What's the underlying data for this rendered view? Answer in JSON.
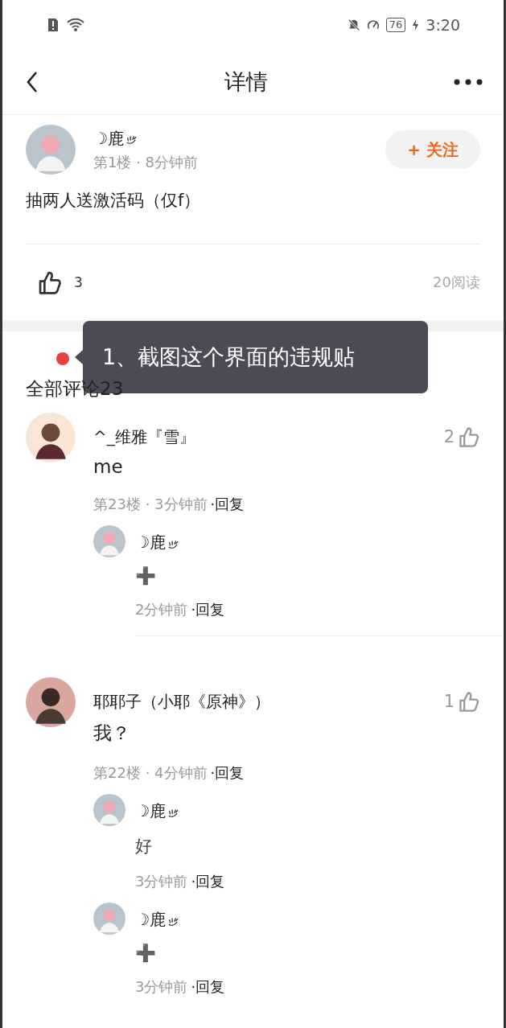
{
  "status_bar": {
    "battery": "76",
    "time": "3:20"
  },
  "header": {
    "title": "详情"
  },
  "post": {
    "author": "☽鹿",
    "floor_time": "第1楼 · 8分钟前",
    "follow": "+ 关注",
    "content": "抽两人送激活码（仅f）",
    "likes": "3",
    "reads": "20阅读"
  },
  "comments_header": "全部评论23",
  "tooltip": "1、截图这个界面的违规贴",
  "comments": [
    {
      "author": "^_维雅『雪』",
      "likes": "2",
      "content": "me",
      "floor_time": "第23楼 · 3分钟前",
      "reply": "·回复",
      "replies": [
        {
          "author": "☽鹿",
          "content": "➕",
          "time": "2分钟前",
          "reply": "·回复"
        }
      ]
    },
    {
      "author": "耶耶子（小耶《原神》）",
      "likes": "1",
      "content": "我？",
      "floor_time": "第22楼 · 4分钟前",
      "reply": "·回复",
      "replies": [
        {
          "author": "☽鹿",
          "content": "好",
          "time": "3分钟前",
          "reply": "·回复"
        },
        {
          "author": "☽鹿",
          "content": "➕",
          "time": "3分钟前",
          "reply": "·回复"
        }
      ]
    }
  ]
}
